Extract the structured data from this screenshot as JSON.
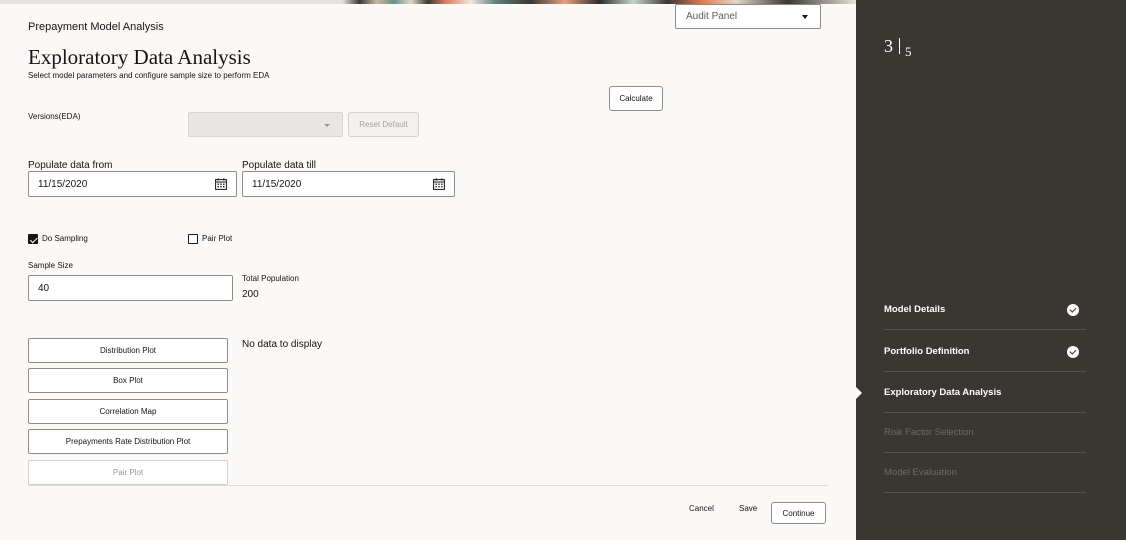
{
  "header": {
    "app_title": "Prepayment Model Analysis",
    "page_title": "Exploratory Data Analysis",
    "page_subtitle": "Select model parameters and configure sample size to perform EDA",
    "audit_panel": "Audit Panel"
  },
  "form": {
    "calculate_label": "Calculate",
    "versions_label": "Versions(EDA)",
    "versions_value": "",
    "reset_default_label": "Reset Default",
    "populate_from_label": "Populate data from",
    "populate_from_value": "11/15/2020",
    "populate_till_label": "Populate data till",
    "populate_till_value": "11/15/2020",
    "do_sampling_label": "Do Sampling",
    "do_sampling_checked": true,
    "pair_plot_label": "Pair Plot",
    "pair_plot_checked": false,
    "sample_size_label": "Sample Size",
    "sample_size_value": "40",
    "total_population_label": "Total Population",
    "total_population_value": "200"
  },
  "plots": {
    "buttons": [
      "Distribution Plot",
      "Box Plot",
      "Correlation Map",
      "Prepayments Rate Distribution Plot",
      "Pair Plot"
    ],
    "no_data": "No data to display"
  },
  "footer": {
    "cancel": "Cancel",
    "save": "Save",
    "continue": "Continue"
  },
  "sidebar": {
    "current_step": "3",
    "total_steps": "5",
    "steps": [
      {
        "label": "Model Details",
        "status": "complete"
      },
      {
        "label": "Portfolio Definition",
        "status": "complete"
      },
      {
        "label": "Exploratory Data Analysis",
        "status": "current"
      },
      {
        "label": "Risk Factor Selection",
        "status": "pending"
      },
      {
        "label": "Model Evaluation",
        "status": "pending"
      }
    ]
  },
  "colors": {
    "sidebar_bg": "#3a3632",
    "page_bg": "#fbf9f8"
  }
}
